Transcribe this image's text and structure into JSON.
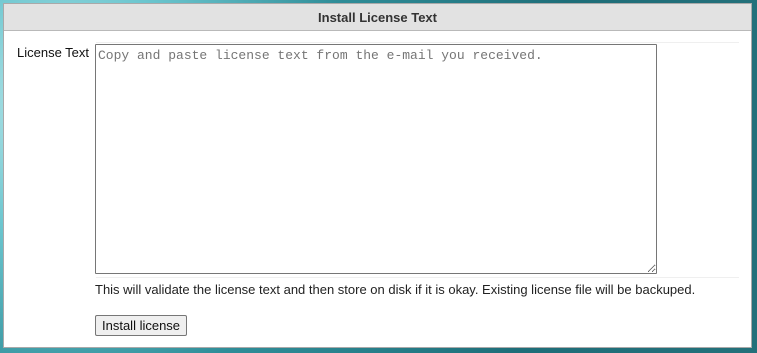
{
  "panel": {
    "title": "Install License Text"
  },
  "form": {
    "license_label": "License Text",
    "license_textarea": {
      "value": "",
      "placeholder": "Copy and paste license text from the e-mail you received."
    },
    "help_text": "This will validate the license text and then store on disk if it is okay. Existing license file will be backuped.",
    "install_button_label": "Install license"
  }
}
